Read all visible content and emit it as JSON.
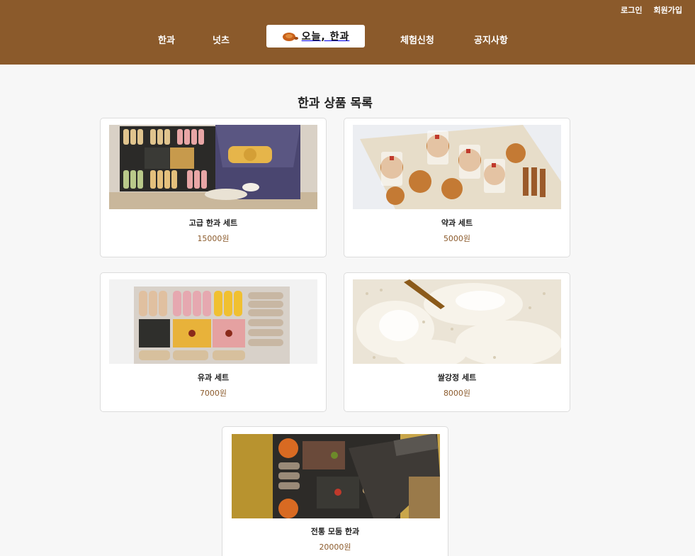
{
  "header": {
    "auth": {
      "login": "로그인",
      "signup": "회원가입"
    },
    "nav": {
      "hangwa": "한과",
      "nuts": "넛츠",
      "experience": "체험신청",
      "notice": "공지사항"
    },
    "logo_text": "오늘, 한과"
  },
  "main": {
    "title": "한과 상품 목록"
  },
  "products": [
    {
      "name": "고급 한과 세트",
      "price": "15000원"
    },
    {
      "name": "약과 세트",
      "price": "5000원"
    },
    {
      "name": "유과 세트",
      "price": "7000원"
    },
    {
      "name": "쌀강정 세트",
      "price": "8000원"
    },
    {
      "name": "전통 모둠 한과",
      "price": "20000원"
    }
  ]
}
